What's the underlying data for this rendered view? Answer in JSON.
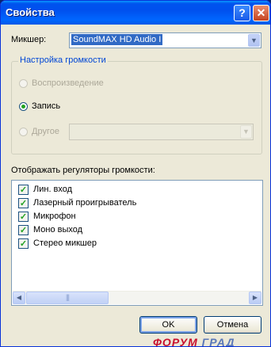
{
  "window": {
    "title": "Свойства"
  },
  "titlebar": {
    "help_glyph": "?",
    "close_glyph": "✕"
  },
  "mixer": {
    "label": "Микшер:",
    "value": "SoundMAX HD Audio I",
    "arrow_glyph": "▼"
  },
  "volume_group": {
    "legend": "Настройка громкости",
    "options": [
      {
        "label": "Воспроизведение",
        "selected": false,
        "enabled": false
      },
      {
        "label": "Запись",
        "selected": true,
        "enabled": true
      },
      {
        "label": "Другое",
        "selected": false,
        "enabled": false
      }
    ],
    "other_select": {
      "value": "",
      "arrow_glyph": "▼",
      "enabled": false
    }
  },
  "controls": {
    "label": "Отображать регуляторы громкости:",
    "items": [
      {
        "label": "Лин. вход",
        "checked": true
      },
      {
        "label": "Лазерный проигрыватель",
        "checked": true
      },
      {
        "label": "Микрофон",
        "checked": true
      },
      {
        "label": "Моно выход",
        "checked": true
      },
      {
        "label": "Стерео микшер",
        "checked": true
      }
    ],
    "check_glyph": "✓",
    "scrollbar": {
      "left_glyph": "◀",
      "right_glyph": "▶",
      "thumb_grip": "|||"
    }
  },
  "buttons": {
    "ok": "OK",
    "cancel": "Отмена"
  },
  "watermark": {
    "part1": "ФОРУМ",
    "part2": "ГРАД"
  },
  "colors": {
    "title_bar": "#0054e3",
    "window_bg": "#ece9d8",
    "group_legend": "#0046d5",
    "check_green": "#21a121"
  }
}
